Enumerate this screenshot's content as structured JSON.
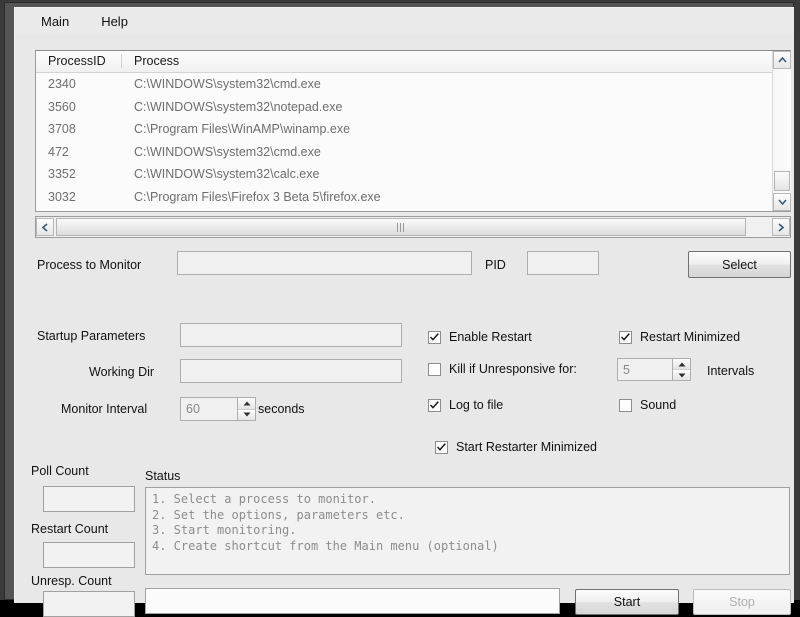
{
  "window": {
    "menu": [
      {
        "label": "Main"
      },
      {
        "label": "Help"
      }
    ]
  },
  "process_list": {
    "columns": [
      "ProcessID",
      "Process"
    ],
    "rows": [
      {
        "pid": "2340",
        "path": "C:\\WINDOWS\\system32\\cmd.exe"
      },
      {
        "pid": "3560",
        "path": "C:\\WINDOWS\\system32\\notepad.exe"
      },
      {
        "pid": "3708",
        "path": "C:\\Program Files\\WinAMP\\winamp.exe"
      },
      {
        "pid": "472",
        "path": "C:\\WINDOWS\\system32\\cmd.exe"
      },
      {
        "pid": "3352",
        "path": "C:\\WINDOWS\\system32\\calc.exe"
      },
      {
        "pid": "3032",
        "path": "C:\\Program Files\\Firefox 3 Beta 5\\firefox.exe"
      }
    ]
  },
  "monitor": {
    "process_label": "Process to Monitor",
    "process_value": "",
    "pid_label": "PID",
    "pid_value": "",
    "select_button": "Select"
  },
  "settings": {
    "startup_params_label": "Startup Parameters",
    "startup_params_value": "",
    "working_dir_label": "Working Dir",
    "working_dir_value": "",
    "monitor_interval_label": "Monitor Interval",
    "monitor_interval_value": "60",
    "seconds_label": "seconds"
  },
  "options": {
    "enable_restart": {
      "label": "Enable Restart",
      "checked": true
    },
    "restart_minimized": {
      "label": "Restart Minimized",
      "checked": true
    },
    "kill_if_unresponsive": {
      "label": "Kill if Unresponsive for:",
      "checked": false
    },
    "kill_intervals_value": "5",
    "intervals_label": "Intervals",
    "log_to_file": {
      "label": "Log to file",
      "checked": true
    },
    "sound": {
      "label": "Sound",
      "checked": false
    },
    "start_restarter_minimized": {
      "label": "Start Restarter Minimized",
      "checked": true
    }
  },
  "counters": {
    "poll_count_label": "Poll Count",
    "poll_count_value": "",
    "restart_count_label": "Restart Count",
    "restart_count_value": "",
    "unresp_count_label": "Unresp. Count",
    "unresp_count_value": ""
  },
  "status": {
    "label": "Status",
    "text": "1. Select a process to monitor.\n2. Set the options, parameters etc.\n3. Start monitoring.\n4. Create shortcut from the Main menu (optional)"
  },
  "footer": {
    "input_value": "",
    "start_button": "Start",
    "secondary_button": "Stop"
  },
  "colors": {
    "face": "#e8e8e8",
    "field": "#f0f0f0",
    "text": "#111111",
    "disabled_text": "#8a8a8a",
    "border": "#9b9b9b"
  }
}
